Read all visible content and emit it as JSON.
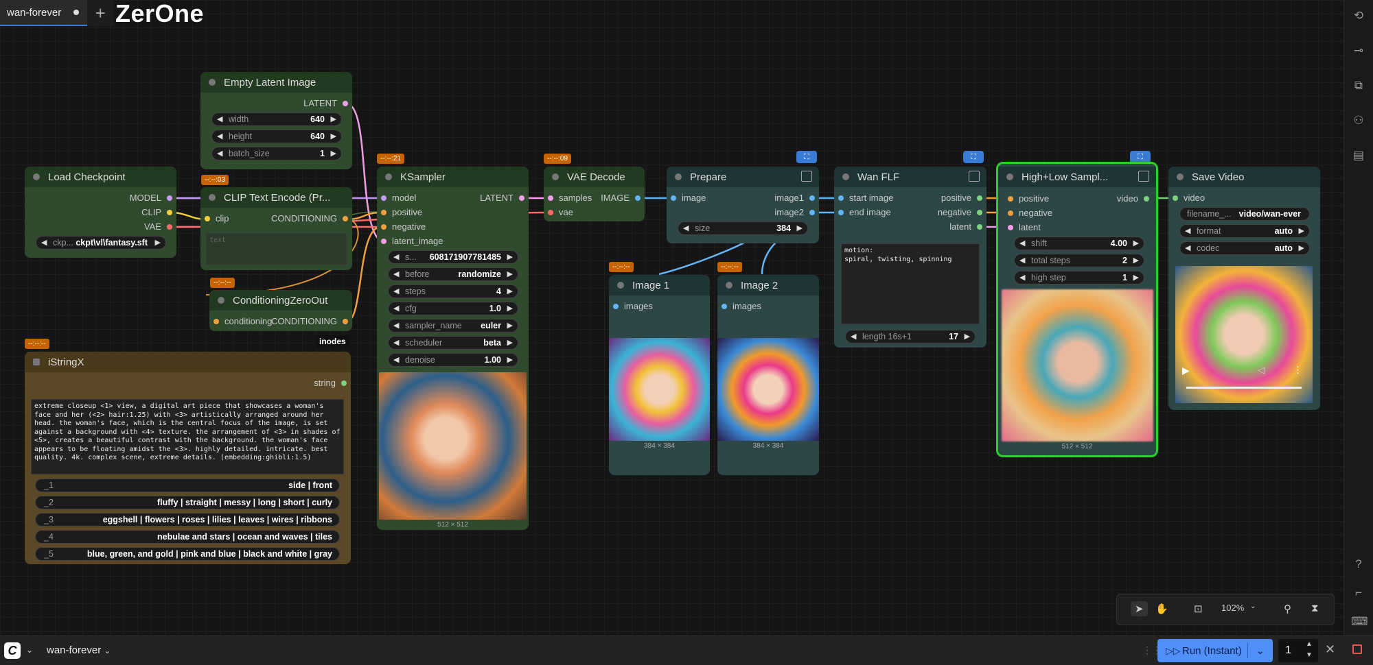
{
  "tabs": [
    {
      "label": "wan-forever",
      "modified": true
    }
  ],
  "brand": "ZerOne",
  "colors": {
    "accent": "#4f8ff7",
    "badge": "#c46300",
    "selected_outline": "#2bd12b"
  },
  "nodes": {
    "empty_latent": {
      "title": "Empty Latent Image",
      "out": "LATENT",
      "widgets": [
        {
          "label": "width",
          "value": "640"
        },
        {
          "label": "height",
          "value": "640"
        },
        {
          "label": "batch_size",
          "value": "1"
        }
      ]
    },
    "load_checkpoint": {
      "title": "Load Checkpoint",
      "outs": [
        "MODEL",
        "CLIP",
        "VAE"
      ],
      "widget": {
        "label": "ckp...",
        "value": "ckpt\\vl\\fantasy.sft"
      }
    },
    "clip_text": {
      "badge": "--:--:03",
      "title": "CLIP Text Encode (Pr...",
      "in": "clip",
      "out": "CONDITIONING",
      "placeholder": "text"
    },
    "cond_zero": {
      "badge": "--:--:--",
      "title": "ConditioningZeroOut",
      "in": "conditioning",
      "out": "CONDITIONING",
      "tooltip": "inodes"
    },
    "istring": {
      "badge": "--:--:--",
      "title": "iStringX",
      "out": "string",
      "text": "extreme closeup <1> view, a digital art piece that showcases a woman's face and her (<2> hair:1.25) with <3> artistically arranged around her head. the woman's face, which is the central focus of the image, is set against a background with <4> texture. the arrangement of <3> in shades of <5>, creates a beautiful contrast with the background. the woman's face appears to be floating amidst the <3>. highly detailed. intricate. best quality. 4k. complex scene, extreme details. (embedding:ghibli:1.5)",
      "options": [
        {
          "label": "_1",
          "value": "side | front"
        },
        {
          "label": "_2",
          "value": "fluffy | straight | messy | long | short | curly"
        },
        {
          "label": "_3",
          "value": "eggshell | flowers | roses | lilies | leaves | wires | ribbons"
        },
        {
          "label": "_4",
          "value": "nebulae and stars | ocean and waves | tiles"
        },
        {
          "label": "_5",
          "value": "blue, green, and gold | pink and blue | black and white | gray"
        }
      ]
    },
    "ksampler": {
      "badge": "--:--:21",
      "title": "KSampler",
      "ins": [
        "model",
        "positive",
        "negative",
        "latent_image"
      ],
      "out": "LATENT",
      "widgets": [
        {
          "label": "s...",
          "value": "608171907781485"
        },
        {
          "label": "before",
          "value": "randomize"
        },
        {
          "label": "steps",
          "value": "4"
        },
        {
          "label": "cfg",
          "value": "1.0"
        },
        {
          "label": "sampler_name",
          "value": "euler"
        },
        {
          "label": "scheduler",
          "value": "beta"
        },
        {
          "label": "denoise",
          "value": "1.00"
        }
      ],
      "preview_caption": "512 × 512"
    },
    "vae_decode": {
      "badge": "--:--:09",
      "title": "VAE Decode",
      "ins": [
        "samples",
        "vae"
      ],
      "out": "IMAGE"
    },
    "prepare": {
      "title": "Prepare",
      "in": "image",
      "outs": [
        "image1",
        "image2"
      ],
      "widget": {
        "label": "size",
        "value": "384"
      }
    },
    "image1": {
      "badge": "--:--:--",
      "title": "Image 1",
      "in": "images",
      "caption": "384 × 384"
    },
    "image2": {
      "badge": "--:--:--",
      "title": "Image 2",
      "in": "images",
      "caption": "384 × 384"
    },
    "wan_flf": {
      "title": "Wan FLF",
      "ins": [
        "start image",
        "end image"
      ],
      "outs": [
        "positive",
        "negative",
        "latent"
      ],
      "text": "motion:\nspiral, twisting, spinning",
      "widget": {
        "label": "length 16s+1",
        "value": "17"
      }
    },
    "high_low": {
      "title": "High+Low Sampl...",
      "ins": [
        "positive",
        "negative",
        "latent"
      ],
      "out": "video",
      "widgets": [
        {
          "label": "shift",
          "value": "4.00"
        },
        {
          "label": "total steps",
          "value": "2"
        },
        {
          "label": "high step",
          "value": "1"
        }
      ],
      "caption": "512 × 512"
    },
    "save_video": {
      "title": "Save Video",
      "in": "video",
      "widgets": [
        {
          "label": "filename_...",
          "value": "video/wan-ever"
        },
        {
          "label": "format",
          "value": "auto"
        },
        {
          "label": "codec",
          "value": "auto"
        }
      ]
    }
  },
  "toolbar": {
    "zoom": "102%"
  },
  "bottom": {
    "workflow": "wan-forever",
    "run_label": "Run (Instant)",
    "run_count": "1"
  }
}
